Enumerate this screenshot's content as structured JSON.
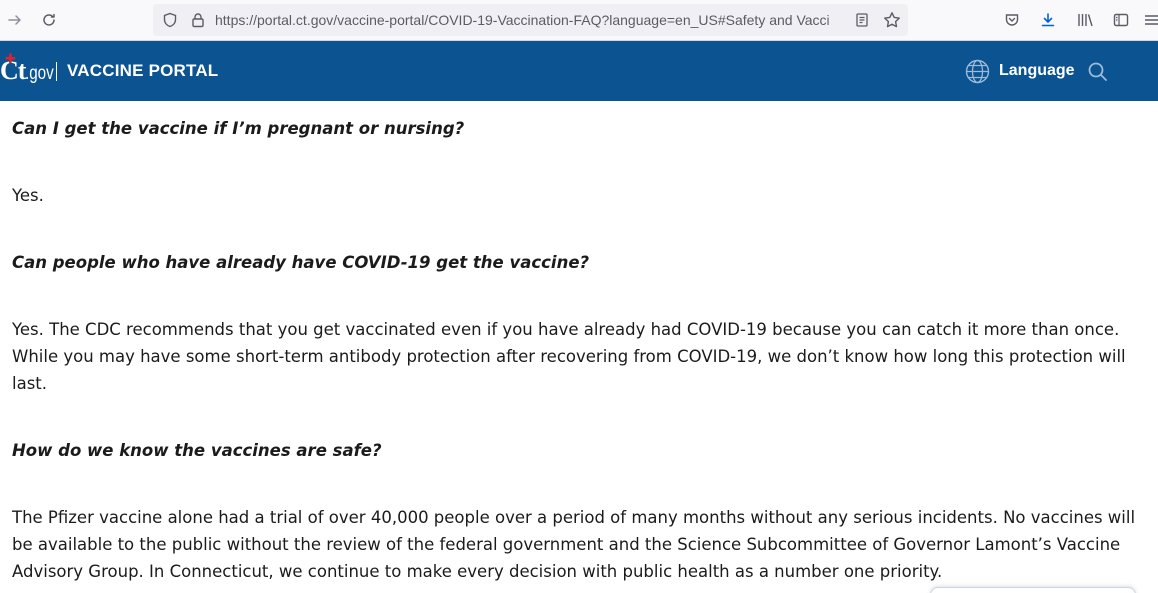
{
  "browser": {
    "url": "https://portal.ct.gov/vaccine-portal/COVID-19-Vaccination-FAQ?language=en_US#Safety and Vacci"
  },
  "header": {
    "logo_main": "Ct",
    "logo_suffix": ".gov",
    "title": "VACCINE PORTAL",
    "language_label": "Language",
    "brand_color": "#0b5391",
    "logo_accent_color": "#e0222a"
  },
  "faq": [
    {
      "question": "Can I get the vaccine if I’m pregnant or nursing?",
      "answer": "Yes."
    },
    {
      "question": "Can people who have already have COVID-19 get the vaccine?",
      "answer": "Yes. The CDC recommends that you get vaccinated even if you have already had COVID-19 because you can catch it more than once. While you may have some short-term antibody protection after recovering from COVID-19, we don’t know how long this protection will last."
    },
    {
      "question": "How do we know the vaccines are safe?",
      "answer": "The Pfizer vaccine alone had a trial of over 40,000 people over a period of many months without any serious incidents. No vaccines will be available to the public without the review of the federal government and the Science Subcommittee of Governor Lamont’s Vaccine Advisory Group. In Connecticut, we continue to make every decision with public health as a number one priority."
    }
  ],
  "icons": {
    "forward": "forward-arrow-icon",
    "reload": "reload-icon",
    "shield": "tracking-shield-icon",
    "lock": "lock-icon",
    "reader": "reader-view-icon",
    "bookmark": "bookmark-star-icon",
    "pocket": "pocket-icon",
    "downloads": "downloads-icon",
    "library": "library-icon",
    "sidebar": "sidebar-icon",
    "menu": "hamburger-menu-icon",
    "globe": "globe-icon",
    "search": "search-icon"
  }
}
